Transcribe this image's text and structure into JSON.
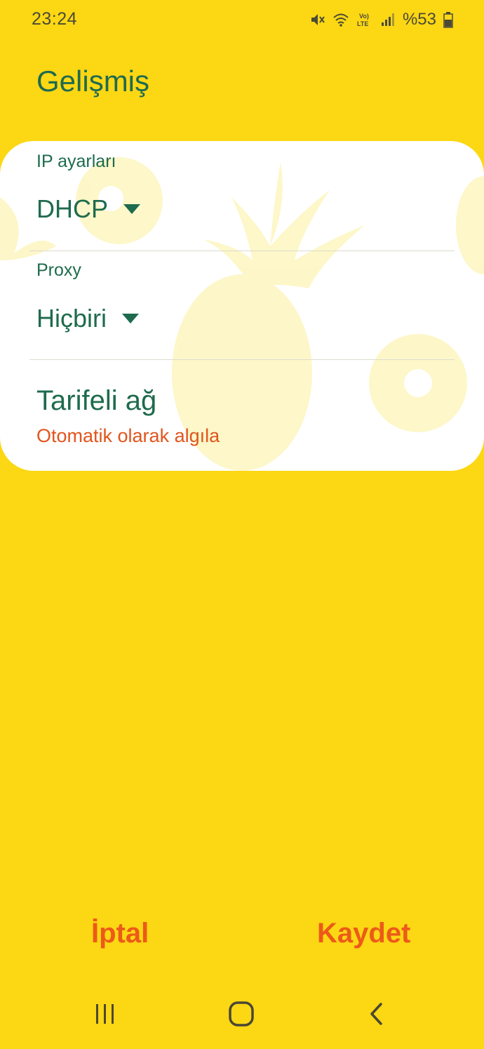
{
  "status_bar": {
    "time": "23:24",
    "battery": "%53",
    "icons": [
      "mute-icon",
      "wifi-icon",
      "volte-icon",
      "signal-icon",
      "battery-icon"
    ]
  },
  "page": {
    "title": "Gelişmiş"
  },
  "ip_settings": {
    "label": "IP ayarları",
    "value": "DHCP"
  },
  "proxy": {
    "label": "Proxy",
    "value": "Hiçbiri"
  },
  "metered": {
    "title": "Tarifeli ağ",
    "subtitle": "Otomatik olarak algıla"
  },
  "actions": {
    "cancel_label": "İptal",
    "save_label": "Kaydet"
  },
  "nav": {
    "icons": [
      "recent-apps-icon",
      "home-icon",
      "back-icon"
    ]
  },
  "colors": {
    "background": "#fcd714",
    "card": "#ffffff",
    "primary_text": "#1e6b4e",
    "accent": "#ec5a19",
    "subtitle": "#e0551e"
  }
}
